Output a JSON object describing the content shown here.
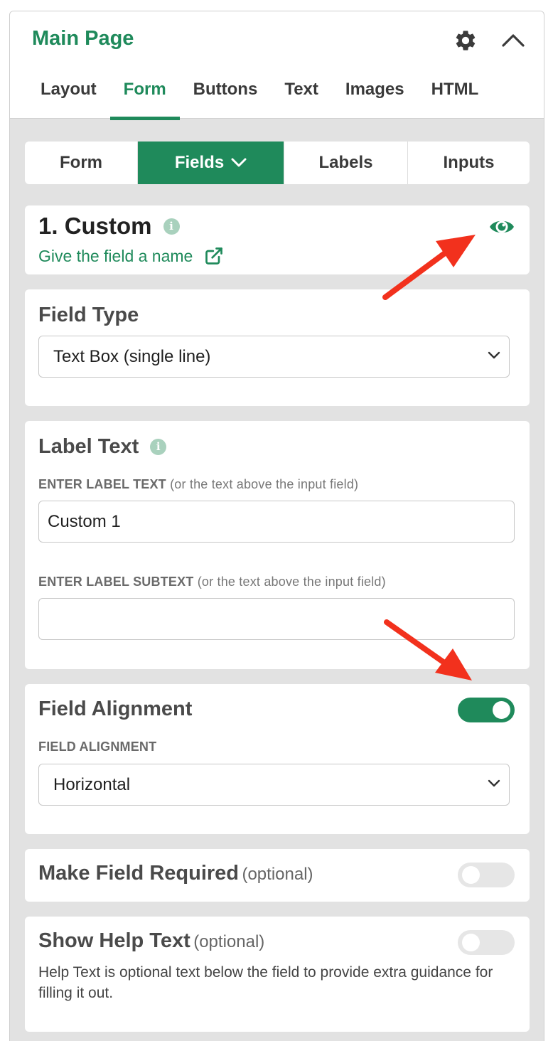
{
  "header": {
    "title": "Main Page",
    "tabs": [
      "Layout",
      "Form",
      "Buttons",
      "Text",
      "Images",
      "HTML"
    ],
    "active_tab": "Form",
    "icons": [
      "gear-icon",
      "chevron-up-icon"
    ]
  },
  "subtabs": {
    "items": [
      "Form",
      "Fields",
      "Labels",
      "Inputs"
    ],
    "active": "Fields"
  },
  "field": {
    "title": "1. Custom",
    "link": "Give the field a name",
    "icons": [
      "info-icon",
      "external-link-icon",
      "eye-icon"
    ]
  },
  "field_type": {
    "heading": "Field Type",
    "selected": "Text Box (single line)"
  },
  "label_text": {
    "heading": "Label Text",
    "label_caption_strong": "ENTER LABEL TEXT",
    "label_caption_note": "(or the text above the input field)",
    "label_value": "Custom 1",
    "subtext_caption_strong": "ENTER LABEL SUBTEXT",
    "subtext_caption_note": "(or the text above the input field)",
    "subtext_value": ""
  },
  "alignment": {
    "heading": "Field Alignment",
    "toggle_on": true,
    "caption": "FIELD ALIGNMENT",
    "selected": "Horizontal"
  },
  "required": {
    "heading": "Make Field Required",
    "optional": "(optional)",
    "toggle_on": false
  },
  "help": {
    "heading": "Show Help Text",
    "optional": "(optional)",
    "toggle_on": false,
    "description": "Help Text is optional text below the field to provide extra guidance for filling it out."
  },
  "colors": {
    "accent": "#1f8a5b",
    "annotation_arrow": "#f2311d"
  }
}
